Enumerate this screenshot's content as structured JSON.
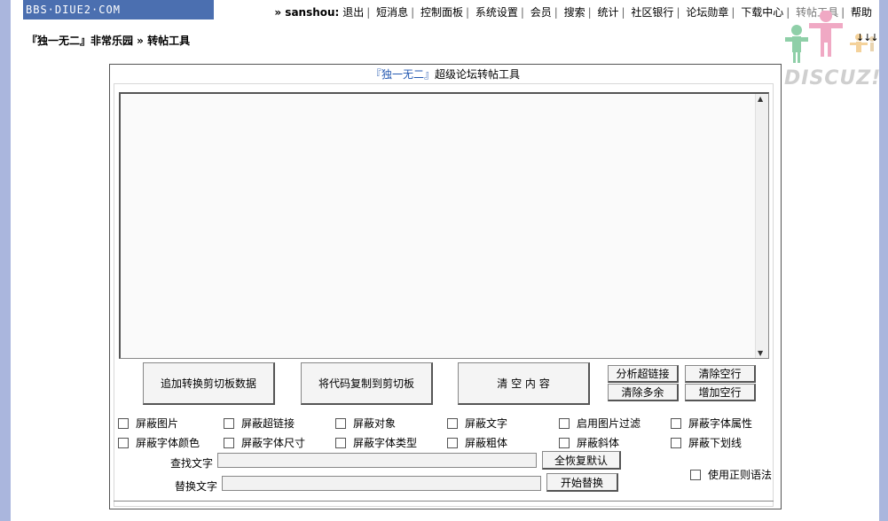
{
  "header": {
    "logo_text": "BBS·DIUE2·COM",
    "user": "» sanshou:",
    "nav": [
      "退出",
      "短消息",
      "控制面板",
      "系统设置",
      "会员",
      "搜索",
      "统计",
      "社区银行",
      "论坛勋章",
      "下载中心",
      "转帖工具",
      "帮助"
    ],
    "discuz_text": "DISCUZ!",
    "arrows": "↓↓↓"
  },
  "breadcrumb": "『独一无二』非常乐园 » 转帖工具",
  "panel": {
    "title_highlight": "『独一无二』",
    "title_rest": "超级论坛转帖工具"
  },
  "buttons": {
    "append": "追加转换剪切板数据",
    "copy": "将代码复制到剪切板",
    "clear": "清 空 内 容",
    "analyze_links": "分析超链接",
    "clear_empty": "清除空行",
    "clear_extra": "清除多余",
    "add_empty": "增加空行",
    "restore_default": "全恢复默认",
    "start_replace": "开始替换"
  },
  "options_row1": [
    "屏蔽图片",
    "屏蔽超链接",
    "屏蔽对象",
    "屏蔽文字",
    "启用图片过滤",
    "屏蔽字体属性"
  ],
  "options_row2": [
    "屏蔽字体颜色",
    "屏蔽字体尺寸",
    "屏蔽字体类型",
    "屏蔽粗体",
    "屏蔽斜体",
    "屏蔽下划线"
  ],
  "find": {
    "label": "查找文字",
    "value": ""
  },
  "replace": {
    "label": "替换文字",
    "value": ""
  },
  "regex_label": "使用正则语法"
}
